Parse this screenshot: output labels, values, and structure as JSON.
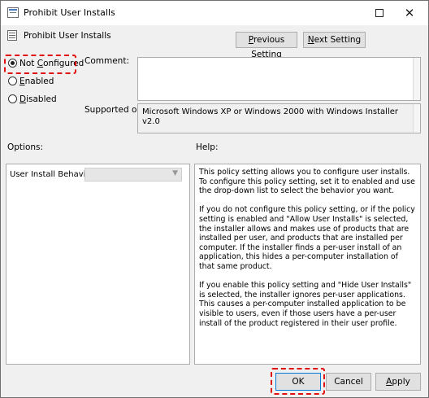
{
  "window": {
    "title": "Prohibit User Installs",
    "title_icon": "policy-setting-icon",
    "maximize_icon": "maximize-icon",
    "close_icon": "close-icon",
    "close_glyph": "✕"
  },
  "header": {
    "title": "Prohibit User Installs",
    "icon": "policy-setting-icon",
    "previous_label": "Previous Setting",
    "next_label": "Next Setting"
  },
  "state": {
    "options": [
      {
        "label": "Not Configured",
        "checked": true
      },
      {
        "label": "Enabled",
        "checked": false
      },
      {
        "label": "Disabled",
        "checked": false
      }
    ]
  },
  "comment": {
    "label": "Comment:",
    "value": ""
  },
  "supported": {
    "label": "Supported on:",
    "value": "Microsoft Windows XP or Windows 2000 with Windows Installer v2.0"
  },
  "options_section": {
    "label": "Options:",
    "field_label": "User Install Behavior:",
    "field_value": ""
  },
  "help_section": {
    "label": "Help:",
    "paragraphs": [
      "This policy setting allows you to configure user installs. To configure this policy setting, set it to enabled and use the drop-down list to select the behavior you want.",
      "If you do not configure this policy setting, or if the policy setting is enabled and \"Allow User Installs\" is selected, the installer allows and makes use of products that are installed per user, and products that are installed per computer. If the installer finds a per-user install of an application, this hides a per-computer installation of that same product.",
      "If you enable this policy setting and \"Hide User Installs\" is selected, the installer ignores per-user applications. This causes a per-computer installed application to be visible to users, even if those users have a per-user install of the product registered in their user profile."
    ]
  },
  "footer": {
    "ok_label": "OK",
    "cancel_label": "Cancel",
    "apply_label": "Apply"
  },
  "colors": {
    "highlight": "#e01010",
    "focus_border": "#0078d7",
    "dialog_background": "#f0f0f0"
  }
}
